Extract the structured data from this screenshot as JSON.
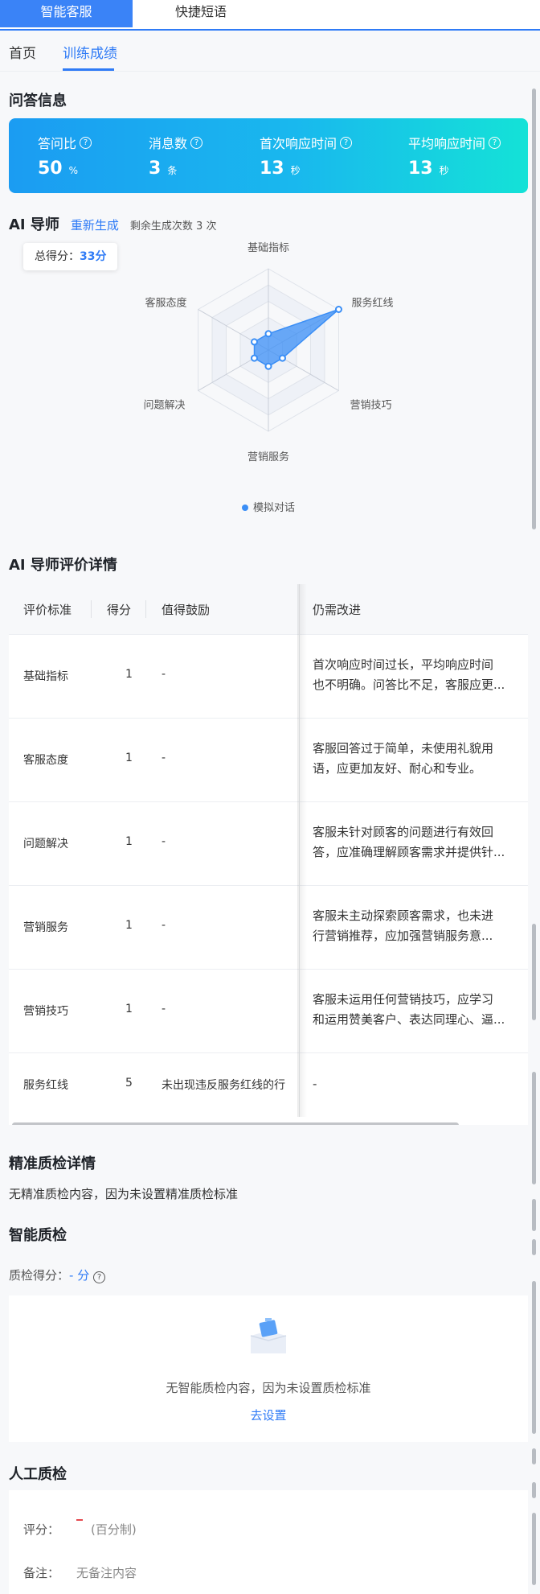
{
  "top_tabs": [
    {
      "label": "智能客服"
    },
    {
      "label": "快捷短语"
    }
  ],
  "sub_tabs": [
    {
      "label": "首页"
    },
    {
      "label": "训练成绩"
    }
  ],
  "qa_info": {
    "title": "问答信息",
    "stats": [
      {
        "label": "答问比",
        "value": "50",
        "unit": "%"
      },
      {
        "label": "消息数",
        "value": "3",
        "unit": "条"
      },
      {
        "label": "首次响应时间",
        "value": "13",
        "unit": "秒"
      },
      {
        "label": "平均响应时间",
        "value": "13",
        "unit": "秒"
      }
    ]
  },
  "ai_mentor": {
    "title": "AI 导师",
    "regenerate": "重新生成",
    "remaining": "剩余生成次数 3 次",
    "total_score_label": "总得分：",
    "total_score_value": "33分",
    "legend": "模拟对话"
  },
  "chart_data": {
    "type": "radar",
    "axes": [
      "基础指标",
      "服务红线",
      "营销技巧",
      "营销服务",
      "问题解决",
      "客服态度"
    ],
    "series": [
      {
        "name": "模拟对话",
        "values": [
          1,
          5,
          1,
          1,
          1,
          1
        ]
      }
    ],
    "range": [
      0,
      5
    ],
    "color": "#3a8ef6"
  },
  "evaluation": {
    "title": "AI 导师评价详情",
    "headers": {
      "criteria": "评价标准",
      "score": "得分",
      "encourage": "值得鼓励",
      "improve": "仍需改进"
    },
    "rows": [
      {
        "criteria": "基础指标",
        "score": "1",
        "encourage": "-",
        "improve_l1": "首次响应时间过长，平均响应时间",
        "improve_l2": "也不明确。问答比不足，客服应更..."
      },
      {
        "criteria": "客服态度",
        "score": "1",
        "encourage": "-",
        "improve_l1": "客服回答过于简单，未使用礼貌用",
        "improve_l2": "语，应更加友好、耐心和专业。"
      },
      {
        "criteria": "问题解决",
        "score": "1",
        "encourage": "-",
        "improve_l1": "客服未针对顾客的问题进行有效回",
        "improve_l2": "答，应准确理解顾客需求并提供针..."
      },
      {
        "criteria": "营销服务",
        "score": "1",
        "encourage": "-",
        "improve_l1": "客服未主动探索顾客需求，也未进",
        "improve_l2": "行营销推荐，应加强营销服务意..."
      },
      {
        "criteria": "营销技巧",
        "score": "1",
        "encourage": "-",
        "improve_l1": "客服未运用任何营销技巧，应学习",
        "improve_l2": "和运用赞美客户、表达同理心、逼..."
      },
      {
        "criteria": "服务红线",
        "score": "5",
        "encourage": "未出现违反服务红线的行",
        "improve_l1": "-",
        "improve_l2": ""
      }
    ]
  },
  "precise_qc": {
    "title": "精准质检详情",
    "text": "无精准质检内容，因为未设置精准质检标准"
  },
  "smart_qc": {
    "title": "智能质检",
    "score_label": "质检得分：",
    "score_value": "- 分",
    "empty_text": "无智能质检内容，因为未设置质检标准",
    "link": "去设置"
  },
  "manual_qc": {
    "title": "人工质检",
    "rating_label": "评分：",
    "rating_suffix": "(百分制)",
    "note_label": "备注：",
    "note_value": "无备注内容"
  },
  "colors": {
    "primary": "#2f7bf6",
    "gradient_start": "#1b9cf2",
    "gradient_end": "#14e2d7"
  }
}
